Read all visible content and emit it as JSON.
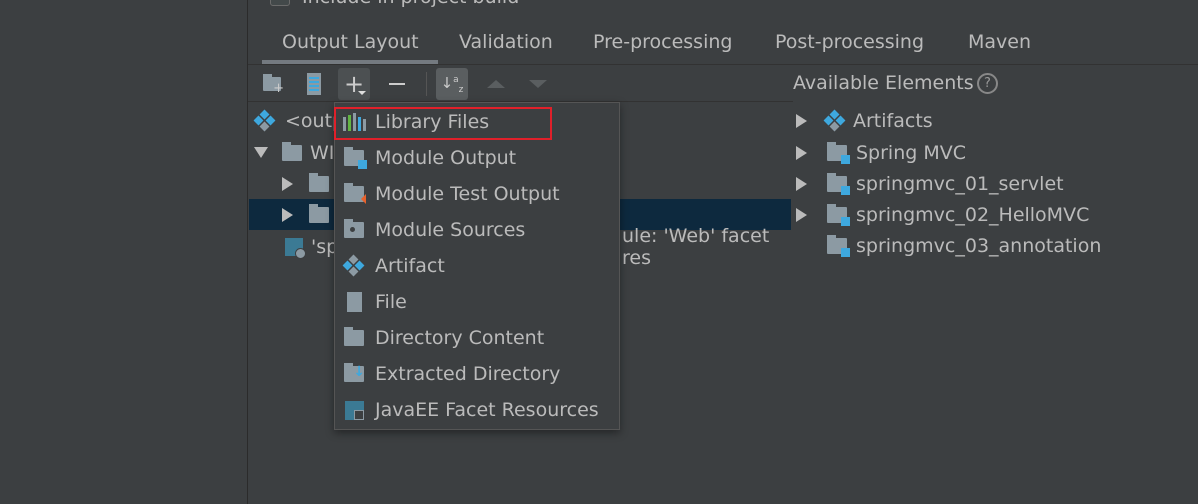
{
  "top_checkbox_label": "Include in project build",
  "tabs": [
    {
      "label": "Output Layout",
      "active": true
    },
    {
      "label": "Validation"
    },
    {
      "label": "Pre-processing"
    },
    {
      "label": "Post-processing"
    },
    {
      "label": "Maven"
    }
  ],
  "toolbar": {
    "icons": [
      "create-directory-icon",
      "create-archive-icon",
      "add-icon",
      "remove-icon",
      "sort-icon",
      "move-up-icon",
      "move-down-icon"
    ]
  },
  "tree": [
    {
      "label": "<output root>",
      "visible": "<outp",
      "icon": "artifact-icon"
    },
    {
      "label": "WEB-INF",
      "visible": "WI",
      "icon": "folder-icon",
      "expanded": true
    },
    {
      "label": "",
      "icon": "folder-icon",
      "indent": 1
    },
    {
      "label": "",
      "icon": "folder-icon",
      "indent": 1,
      "selected": true
    },
    {
      "label": "'springmvc...' module: 'Web' facet resources",
      "visible": "'sp",
      "visible_tail": "ule: 'Web' facet res",
      "icon": "web-facet-icon"
    }
  ],
  "popup": {
    "items": [
      {
        "label": "Library Files",
        "icon": "library-icon",
        "highlighted": true
      },
      {
        "label": "Module Output",
        "icon": "module-output-icon"
      },
      {
        "label": "Module Test Output",
        "icon": "module-test-output-icon"
      },
      {
        "label": "Module Sources",
        "icon": "module-sources-icon"
      },
      {
        "label": "Artifact",
        "icon": "artifact-icon"
      },
      {
        "label": "File",
        "icon": "file-icon"
      },
      {
        "label": "Directory Content",
        "icon": "directory-content-icon"
      },
      {
        "label": "Extracted Directory",
        "icon": "extracted-directory-icon"
      },
      {
        "label": "JavaEE Facet Resources",
        "icon": "javaee-facet-icon"
      }
    ]
  },
  "available": {
    "title": "Available Elements",
    "items": [
      {
        "label": "Artifacts",
        "icon": "artifact-icon"
      },
      {
        "label": "Spring MVC",
        "icon": "module-folder-icon"
      },
      {
        "label": "springmvc_01_servlet",
        "icon": "module-folder-icon"
      },
      {
        "label": "springmvc_02_HelloMVC",
        "icon": "module-folder-icon"
      },
      {
        "label": "springmvc_03_annotation",
        "icon": "module-folder-icon"
      }
    ]
  },
  "colors": {
    "background": "#3c3f41",
    "selection": "#0d293e",
    "highlight_border": "#e0202a",
    "accent_blue": "#3ea8de"
  }
}
